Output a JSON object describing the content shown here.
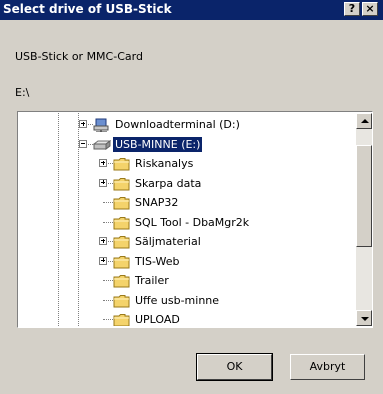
{
  "window": {
    "title": "Select drive of USB-Stick",
    "help_label": "?",
    "close_label": "×"
  },
  "prompt": "USB-Stick or MMC-Card",
  "path": "E:\\",
  "tree": {
    "items": [
      {
        "label": "Downloadterminal (D:)",
        "icon": "network-drive-icon",
        "expander": "plus",
        "selected": false
      },
      {
        "label": "USB-MINNE (E:)",
        "icon": "removable-drive-icon",
        "expander": "minus",
        "selected": true
      },
      {
        "label": "Riskanalys",
        "icon": "folder-icon",
        "expander": "plus",
        "selected": false
      },
      {
        "label": "Skarpa data",
        "icon": "folder-icon",
        "expander": "plus",
        "selected": false
      },
      {
        "label": "SNAP32",
        "icon": "folder-icon",
        "expander": "none",
        "selected": false
      },
      {
        "label": "SQL Tool - DbaMgr2k",
        "icon": "folder-icon",
        "expander": "none",
        "selected": false
      },
      {
        "label": "Säljmaterial",
        "icon": "folder-icon",
        "expander": "plus",
        "selected": false
      },
      {
        "label": "TIS-Web",
        "icon": "folder-icon",
        "expander": "plus",
        "selected": false
      },
      {
        "label": "Trailer",
        "icon": "folder-icon",
        "expander": "none",
        "selected": false
      },
      {
        "label": "Uffe usb-minne",
        "icon": "folder-icon",
        "expander": "none",
        "selected": false
      },
      {
        "label": "UPLOAD",
        "icon": "folder-icon",
        "expander": "none",
        "selected": false
      }
    ]
  },
  "buttons": {
    "ok_label": "OK",
    "cancel_label": "Avbryt"
  },
  "colors": {
    "titlebar": "#0a246a",
    "dialog_bg": "#d4d0c8",
    "selection": "#0a246a",
    "folder": "#f4d36b"
  }
}
